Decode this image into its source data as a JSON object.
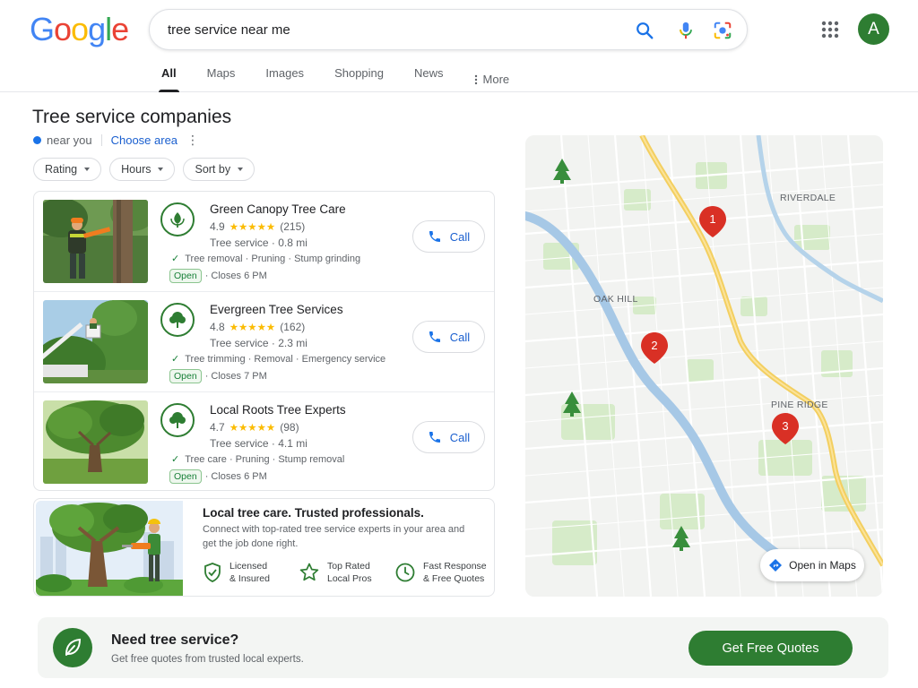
{
  "header": {
    "logo_letters": [
      {
        "char": "G",
        "color": "#4285F4"
      },
      {
        "char": "o",
        "color": "#EA4335"
      },
      {
        "char": "o",
        "color": "#FBBC05"
      },
      {
        "char": "g",
        "color": "#4285F4"
      },
      {
        "char": "l",
        "color": "#34A853"
      },
      {
        "char": "e",
        "color": "#EA4335"
      }
    ],
    "search_query": "tree service near me",
    "avatar_letter": "A"
  },
  "tabs": [
    {
      "label": "All",
      "active": true
    },
    {
      "label": "Maps",
      "active": false
    },
    {
      "label": "Images",
      "active": false
    },
    {
      "label": "Shopping",
      "active": false
    },
    {
      "label": "News",
      "active": false
    },
    {
      "label": "More",
      "active": false
    }
  ],
  "section": {
    "title": "Tree service companies",
    "location": "near you",
    "choose_area": "Choose area"
  },
  "filters": [
    "Rating",
    "Hours",
    "Sort by"
  ],
  "results": [
    {
      "name": "Green Canopy Tree Care",
      "rating": "4.9",
      "stars": "★★★★★",
      "reviews": "(215)",
      "meta": "Tree service · 0.8 mi",
      "services": "Tree removal · Pruning · Stump grinding",
      "open": "Open",
      "hours": "· Closes 6 PM",
      "call": "Call"
    },
    {
      "name": "Evergreen Tree Services",
      "rating": "4.8",
      "stars": "★★★★★",
      "reviews": "(162)",
      "meta": "Tree service · 2.3 mi",
      "services": "Tree trimming · Removal · Emergency service",
      "open": "Open",
      "hours": "· Closes 7 PM",
      "call": "Call"
    },
    {
      "name": "Local Roots Tree Experts",
      "rating": "4.7",
      "stars": "★★★★★",
      "reviews": "(98)",
      "meta": "Tree service · 4.1 mi",
      "services": "Tree care · Pruning · Stump removal",
      "open": "Open",
      "hours": "· Closes 6 PM",
      "call": "Call"
    }
  ],
  "promo": {
    "title": "Local tree care. Trusted professionals.",
    "description": "Connect with top-rated tree service experts in your area and get the job done right.",
    "features": [
      {
        "line1": "Licensed",
        "line2": "& Insured"
      },
      {
        "line1": "Top Rated",
        "line2": "Local Pros"
      },
      {
        "line1": "Fast Response",
        "line2": "& Free Quotes"
      }
    ]
  },
  "map": {
    "labels": [
      "RIVERDALE",
      "OAK HILL",
      "PINE RIDGE"
    ],
    "pins": [
      "1",
      "2",
      "3"
    ],
    "open_in_maps": "Open in Maps"
  },
  "banner": {
    "title": "Need tree service?",
    "subtitle": "Get free quotes from trusted local experts.",
    "button": "Get Free Quotes"
  },
  "colors": {
    "brand_green": "#2e7d32",
    "link_blue": "#1a5fcf",
    "pin_red": "#d93025",
    "star_yellow": "#fbbc04"
  }
}
